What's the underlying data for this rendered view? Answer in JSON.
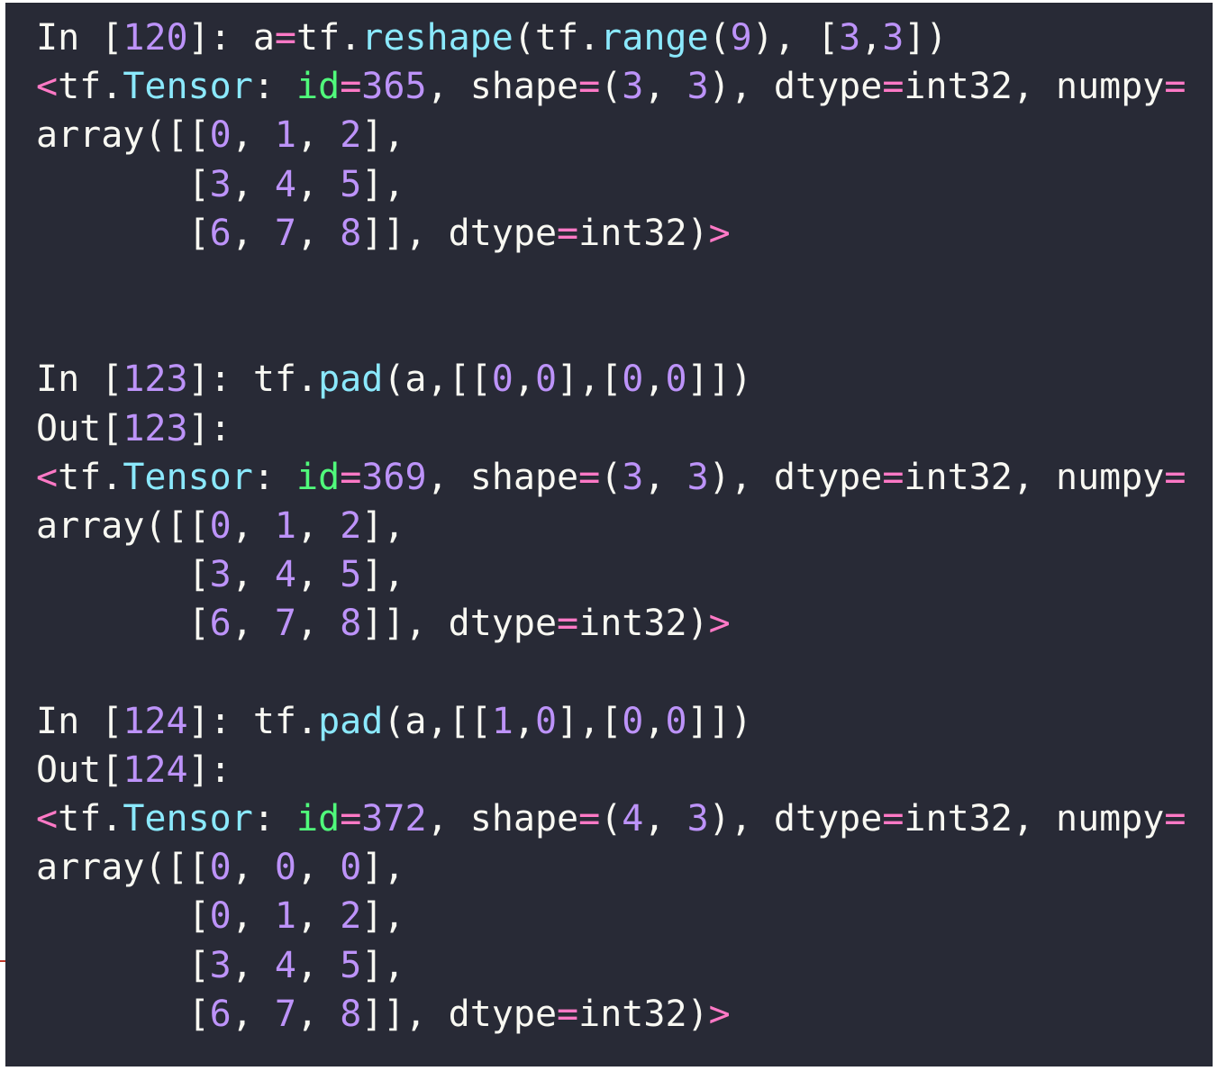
{
  "colors": {
    "background": "#282a36",
    "default": "#f8f8f2",
    "number": "#bd93f9",
    "function": "#8be9fd",
    "keyword": "#ff79c6",
    "attribute": "#50fa7b"
  },
  "cells": [
    {
      "id": "cell-120",
      "lines": [
        [
          [
            "In [",
            "d"
          ],
          [
            "120",
            "n"
          ],
          [
            "]: a",
            "d"
          ],
          [
            "=",
            "k"
          ],
          [
            "tf.",
            "d"
          ],
          [
            "reshape",
            "f"
          ],
          [
            "(tf.",
            "d"
          ],
          [
            "range",
            "f"
          ],
          [
            "(",
            "d"
          ],
          [
            "9",
            "n"
          ],
          [
            "), [",
            "d"
          ],
          [
            "3",
            "n"
          ],
          [
            ",",
            "d"
          ],
          [
            "3",
            "n"
          ],
          [
            "])",
            "d"
          ]
        ],
        [
          [
            "<",
            "k"
          ],
          [
            "tf.",
            "d"
          ],
          [
            "Tensor",
            "f"
          ],
          [
            ": ",
            "d"
          ],
          [
            "id",
            "a"
          ],
          [
            "=",
            "k"
          ],
          [
            "365",
            "n"
          ],
          [
            ", shape",
            "d"
          ],
          [
            "=",
            "k"
          ],
          [
            "(",
            "d"
          ],
          [
            "3",
            "n"
          ],
          [
            ", ",
            "d"
          ],
          [
            "3",
            "n"
          ],
          [
            "), dtype",
            "d"
          ],
          [
            "=",
            "k"
          ],
          [
            "int32, numpy",
            "d"
          ],
          [
            "=",
            "k"
          ]
        ],
        [
          [
            "array([[",
            "d"
          ],
          [
            "0",
            "n"
          ],
          [
            ", ",
            "d"
          ],
          [
            "1",
            "n"
          ],
          [
            ", ",
            "d"
          ],
          [
            "2",
            "n"
          ],
          [
            "],",
            "d"
          ]
        ],
        [
          [
            "       [",
            "d"
          ],
          [
            "3",
            "n"
          ],
          [
            ", ",
            "d"
          ],
          [
            "4",
            "n"
          ],
          [
            ", ",
            "d"
          ],
          [
            "5",
            "n"
          ],
          [
            "],",
            "d"
          ]
        ],
        [
          [
            "       [",
            "d"
          ],
          [
            "6",
            "n"
          ],
          [
            ", ",
            "d"
          ],
          [
            "7",
            "n"
          ],
          [
            ", ",
            "d"
          ],
          [
            "8",
            "n"
          ],
          [
            "]], dtype",
            "d"
          ],
          [
            "=",
            "k"
          ],
          [
            "int32)",
            "d"
          ],
          [
            ">",
            "k"
          ]
        ]
      ]
    },
    {
      "id": "cell-123",
      "lines": [
        [
          [
            "In [",
            "d"
          ],
          [
            "123",
            "n"
          ],
          [
            "]: tf.",
            "d"
          ],
          [
            "pad",
            "f"
          ],
          [
            "(a,[[",
            "d"
          ],
          [
            "0",
            "n"
          ],
          [
            ",",
            "d"
          ],
          [
            "0",
            "n"
          ],
          [
            "],[",
            "d"
          ],
          [
            "0",
            "n"
          ],
          [
            ",",
            "d"
          ],
          [
            "0",
            "n"
          ],
          [
            "]])",
            "d"
          ]
        ],
        [
          [
            "Out[",
            "d"
          ],
          [
            "123",
            "n"
          ],
          [
            "]:",
            "d"
          ]
        ],
        [
          [
            "<",
            "k"
          ],
          [
            "tf.",
            "d"
          ],
          [
            "Tensor",
            "f"
          ],
          [
            ": ",
            "d"
          ],
          [
            "id",
            "a"
          ],
          [
            "=",
            "k"
          ],
          [
            "369",
            "n"
          ],
          [
            ", shape",
            "d"
          ],
          [
            "=",
            "k"
          ],
          [
            "(",
            "d"
          ],
          [
            "3",
            "n"
          ],
          [
            ", ",
            "d"
          ],
          [
            "3",
            "n"
          ],
          [
            "), dtype",
            "d"
          ],
          [
            "=",
            "k"
          ],
          [
            "int32, numpy",
            "d"
          ],
          [
            "=",
            "k"
          ]
        ],
        [
          [
            "array([[",
            "d"
          ],
          [
            "0",
            "n"
          ],
          [
            ", ",
            "d"
          ],
          [
            "1",
            "n"
          ],
          [
            ", ",
            "d"
          ],
          [
            "2",
            "n"
          ],
          [
            "],",
            "d"
          ]
        ],
        [
          [
            "       [",
            "d"
          ],
          [
            "3",
            "n"
          ],
          [
            ", ",
            "d"
          ],
          [
            "4",
            "n"
          ],
          [
            ", ",
            "d"
          ],
          [
            "5",
            "n"
          ],
          [
            "],",
            "d"
          ]
        ],
        [
          [
            "       [",
            "d"
          ],
          [
            "6",
            "n"
          ],
          [
            ", ",
            "d"
          ],
          [
            "7",
            "n"
          ],
          [
            ", ",
            "d"
          ],
          [
            "8",
            "n"
          ],
          [
            "]], dtype",
            "d"
          ],
          [
            "=",
            "k"
          ],
          [
            "int32)",
            "d"
          ],
          [
            ">",
            "k"
          ]
        ]
      ]
    },
    {
      "id": "cell-124",
      "lines": [
        [
          [
            "In [",
            "d"
          ],
          [
            "124",
            "n"
          ],
          [
            "]: tf.",
            "d"
          ],
          [
            "pad",
            "f"
          ],
          [
            "(a,[[",
            "d"
          ],
          [
            "1",
            "n"
          ],
          [
            ",",
            "d"
          ],
          [
            "0",
            "n"
          ],
          [
            "],[",
            "d"
          ],
          [
            "0",
            "n"
          ],
          [
            ",",
            "d"
          ],
          [
            "0",
            "n"
          ],
          [
            "]])",
            "d"
          ]
        ],
        [
          [
            "Out[",
            "d"
          ],
          [
            "124",
            "n"
          ],
          [
            "]:",
            "d"
          ]
        ],
        [
          [
            "<",
            "k"
          ],
          [
            "tf.",
            "d"
          ],
          [
            "Tensor",
            "f"
          ],
          [
            ": ",
            "d"
          ],
          [
            "id",
            "a"
          ],
          [
            "=",
            "k"
          ],
          [
            "372",
            "n"
          ],
          [
            ", shape",
            "d"
          ],
          [
            "=",
            "k"
          ],
          [
            "(",
            "d"
          ],
          [
            "4",
            "n"
          ],
          [
            ", ",
            "d"
          ],
          [
            "3",
            "n"
          ],
          [
            "), dtype",
            "d"
          ],
          [
            "=",
            "k"
          ],
          [
            "int32, numpy",
            "d"
          ],
          [
            "=",
            "k"
          ]
        ],
        [
          [
            "array([[",
            "d"
          ],
          [
            "0",
            "n"
          ],
          [
            ", ",
            "d"
          ],
          [
            "0",
            "n"
          ],
          [
            ", ",
            "d"
          ],
          [
            "0",
            "n"
          ],
          [
            "],",
            "d"
          ]
        ],
        [
          [
            "       [",
            "d"
          ],
          [
            "0",
            "n"
          ],
          [
            ", ",
            "d"
          ],
          [
            "1",
            "n"
          ],
          [
            ", ",
            "d"
          ],
          [
            "2",
            "n"
          ],
          [
            "],",
            "d"
          ]
        ],
        [
          [
            "       [",
            "d"
          ],
          [
            "3",
            "n"
          ],
          [
            ", ",
            "d"
          ],
          [
            "4",
            "n"
          ],
          [
            ", ",
            "d"
          ],
          [
            "5",
            "n"
          ],
          [
            "],",
            "d"
          ]
        ],
        [
          [
            "       [",
            "d"
          ],
          [
            "6",
            "n"
          ],
          [
            ", ",
            "d"
          ],
          [
            "7",
            "n"
          ],
          [
            ", ",
            "d"
          ],
          [
            "8",
            "n"
          ],
          [
            "]], dtype",
            "d"
          ],
          [
            "=",
            "k"
          ],
          [
            "int32)",
            "d"
          ],
          [
            ">",
            "k"
          ]
        ]
      ]
    }
  ]
}
